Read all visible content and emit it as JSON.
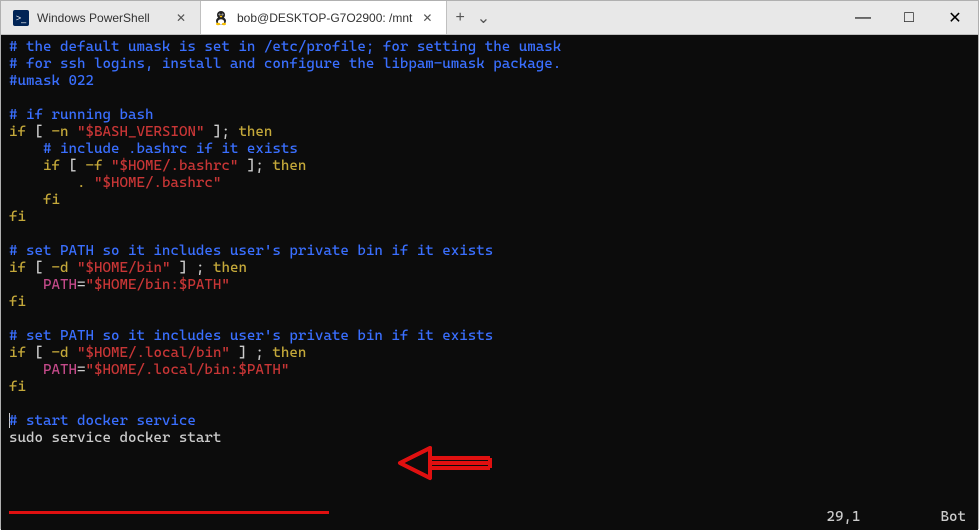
{
  "titlebar": {
    "tabs": [
      {
        "label": "Windows PowerShell",
        "icon": "powershell-icon",
        "active": false
      },
      {
        "label": "bob@DESKTOP-G7O2900: /mnt",
        "icon": "tux-icon",
        "active": true
      }
    ],
    "new_tab": "+",
    "dropdown": "⌄"
  },
  "window_controls": {
    "minimize": "—",
    "maximize": "□",
    "close": "✕"
  },
  "lines": [
    {
      "type": "comment",
      "text": "# the default umask is set in /etc/profile; for setting the umask"
    },
    {
      "type": "comment",
      "text": "# for ssh logins, install and configure the libpam-umask package."
    },
    {
      "type": "comment",
      "text": "#umask 022"
    },
    {
      "type": "blank",
      "text": ""
    },
    {
      "type": "comment",
      "text": "# if running bash"
    },
    {
      "type": "mixed",
      "parts": [
        {
          "c": "yellow",
          "t": "if"
        },
        {
          "c": "white",
          "t": " [ "
        },
        {
          "c": "yellow",
          "t": "-n"
        },
        {
          "c": "white",
          "t": " "
        },
        {
          "c": "red",
          "t": "\"$BASH_VERSION\""
        },
        {
          "c": "white",
          "t": " ]; "
        },
        {
          "c": "yellow",
          "t": "then"
        }
      ]
    },
    {
      "type": "comment",
      "text": "    # include .bashrc if it exists"
    },
    {
      "type": "mixed",
      "parts": [
        {
          "c": "white",
          "t": "    "
        },
        {
          "c": "yellow",
          "t": "if"
        },
        {
          "c": "white",
          "t": " [ "
        },
        {
          "c": "yellow",
          "t": "-f"
        },
        {
          "c": "white",
          "t": " "
        },
        {
          "c": "red",
          "t": "\"$HOME/.bashrc\""
        },
        {
          "c": "white",
          "t": " ]; "
        },
        {
          "c": "yellow",
          "t": "then"
        }
      ]
    },
    {
      "type": "mixed",
      "parts": [
        {
          "c": "white",
          "t": "        "
        },
        {
          "c": "yellow",
          "t": "."
        },
        {
          "c": "white",
          "t": " "
        },
        {
          "c": "red",
          "t": "\"$HOME/.bashrc\""
        }
      ]
    },
    {
      "type": "mixed",
      "parts": [
        {
          "c": "white",
          "t": "    "
        },
        {
          "c": "yellow",
          "t": "fi"
        }
      ]
    },
    {
      "type": "mixed",
      "parts": [
        {
          "c": "yellow",
          "t": "fi"
        }
      ]
    },
    {
      "type": "blank",
      "text": ""
    },
    {
      "type": "comment",
      "text": "# set PATH so it includes user's private bin if it exists"
    },
    {
      "type": "mixed",
      "parts": [
        {
          "c": "yellow",
          "t": "if"
        },
        {
          "c": "white",
          "t": " [ "
        },
        {
          "c": "yellow",
          "t": "-d"
        },
        {
          "c": "white",
          "t": " "
        },
        {
          "c": "red",
          "t": "\"$HOME/bin\""
        },
        {
          "c": "white",
          "t": " ] ; "
        },
        {
          "c": "yellow",
          "t": "then"
        }
      ]
    },
    {
      "type": "mixed",
      "parts": [
        {
          "c": "white",
          "t": "    "
        },
        {
          "c": "magenta",
          "t": "PATH"
        },
        {
          "c": "white",
          "t": "="
        },
        {
          "c": "red",
          "t": "\"$HOME/bin:$PATH\""
        }
      ]
    },
    {
      "type": "mixed",
      "parts": [
        {
          "c": "yellow",
          "t": "fi"
        }
      ]
    },
    {
      "type": "blank",
      "text": ""
    },
    {
      "type": "comment",
      "text": "# set PATH so it includes user's private bin if it exists"
    },
    {
      "type": "mixed",
      "parts": [
        {
          "c": "yellow",
          "t": "if"
        },
        {
          "c": "white",
          "t": " [ "
        },
        {
          "c": "yellow",
          "t": "-d"
        },
        {
          "c": "white",
          "t": " "
        },
        {
          "c": "red",
          "t": "\"$HOME/.local/bin\""
        },
        {
          "c": "white",
          "t": " ] ; "
        },
        {
          "c": "yellow",
          "t": "then"
        }
      ]
    },
    {
      "type": "mixed",
      "parts": [
        {
          "c": "white",
          "t": "    "
        },
        {
          "c": "magenta",
          "t": "PATH"
        },
        {
          "c": "white",
          "t": "="
        },
        {
          "c": "red",
          "t": "\"$HOME/.local/bin:$PATH\""
        }
      ]
    },
    {
      "type": "mixed",
      "parts": [
        {
          "c": "yellow",
          "t": "fi"
        }
      ]
    },
    {
      "type": "blank",
      "text": ""
    },
    {
      "type": "comment-cursor",
      "text": "# start docker service"
    },
    {
      "type": "white",
      "text": "sudo service docker start"
    }
  ],
  "status": {
    "position": "29,1",
    "scroll": "Bot"
  }
}
